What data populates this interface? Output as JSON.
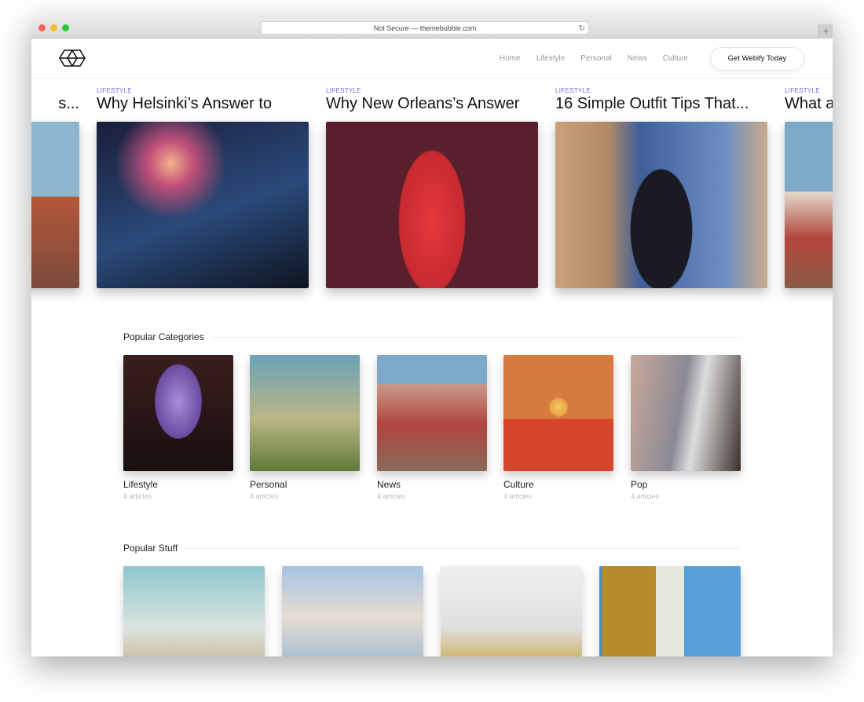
{
  "browser": {
    "url": "Not Secure — themebubble.com"
  },
  "nav": {
    "links": [
      "Home",
      "Lifestyle",
      "Personal",
      "News",
      "Culture"
    ],
    "cta": "Get Webify Today"
  },
  "carousel": [
    {
      "category": "",
      "title": "s..."
    },
    {
      "category": "LIFESTYLE",
      "title": "Why Helsinki’s Answer to"
    },
    {
      "category": "LIFESTYLE",
      "title": "Why New Orleans’s Answer"
    },
    {
      "category": "LIFESTYLE",
      "title": "16 Simple Outfit Tips That..."
    },
    {
      "category": "LIFESTYLE",
      "title": "What a"
    }
  ],
  "popular_categories": {
    "heading": "Popular Categories",
    "items": [
      {
        "name": "Lifestyle",
        "count": "4 articles"
      },
      {
        "name": "Personal",
        "count": "4 articles"
      },
      {
        "name": "News",
        "count": "4 articles"
      },
      {
        "name": "Culture",
        "count": "4 articles"
      },
      {
        "name": "Pop",
        "count": "4 articles"
      }
    ]
  },
  "popular_stuff": {
    "heading": "Popular Stuff"
  }
}
